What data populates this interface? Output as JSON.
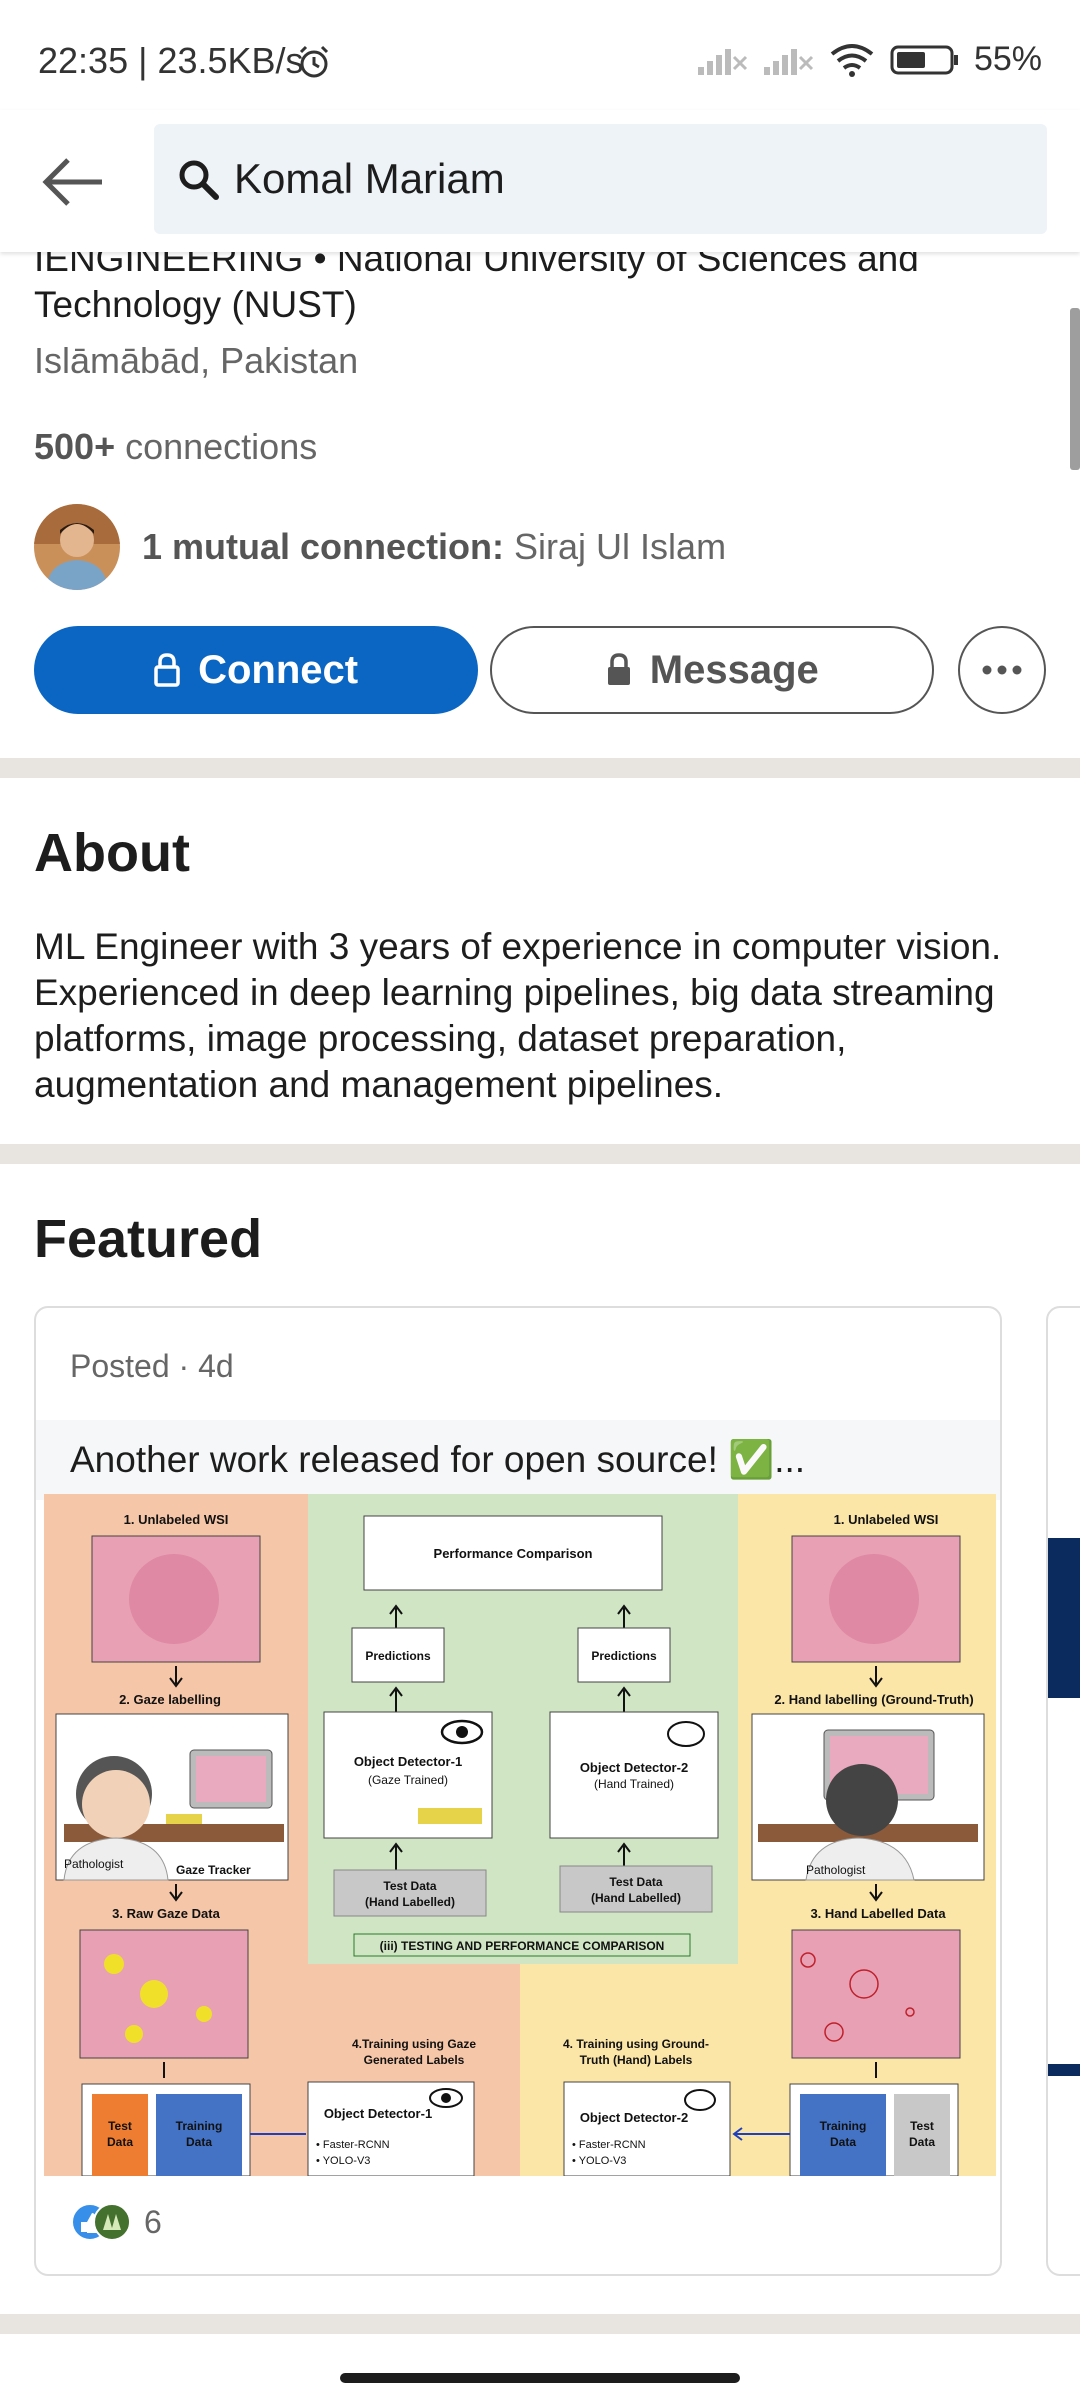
{
  "status_bar": {
    "time_speed": "22:35 | 23.5KB/s",
    "battery": "55%"
  },
  "search": {
    "query": "Komal Mariam"
  },
  "profile": {
    "headline": "IENGINEERING • National University of Sciences and Technology (NUST)",
    "location": "Islāmābād, Pakistan",
    "connections_count": "500+",
    "connections_label": " connections",
    "mutual_label": "1 mutual connection: ",
    "mutual_name": "Siraj Ul Islam",
    "connect_label": "Connect",
    "message_label": "Message"
  },
  "about": {
    "title": "About",
    "text": "ML Engineer with 3 years of experience in computer vision. Experienced in deep learning pipelines, big data streaming platforms, image processing, dataset preparation, augmentation and management pipelines."
  },
  "featured": {
    "title": "Featured",
    "post": {
      "meta": "Posted · 4d",
      "text": "Another work released for open source! ✅...",
      "reaction_count": "6",
      "diagram": {
        "left_title": "1. Unlabeled WSI",
        "gaze_labelling": "2. Gaze labelling",
        "pathologist": "Pathologist",
        "gaze_tracker": "Gaze Tracker",
        "raw_gaze": "3. Raw Gaze Data",
        "performance": "Performance Comparison",
        "predictions": "Predictions",
        "od1": "Object Detector-1",
        "od1_sub": "(Gaze Trained)",
        "od2": "Object Detector-2",
        "od2_sub": "(Hand Trained)",
        "test_data": "Test Data",
        "hand_labelled": "(Hand Labelled)",
        "testing_banner": "(iii) TESTING AND PERFORMANCE COMPARISON",
        "right_title": "1. Unlabeled WSI",
        "hand_labelling": "2. Hand labelling (Ground-Truth)",
        "hand_labelled_data": "3. Hand Labelled Data",
        "train_gaze": "4.Training using Gaze",
        "train_gaze2": "Generated Labels",
        "train_gt": "4. Training using Ground-",
        "train_gt2": "Truth (Hand) Labels",
        "test_box": "Test",
        "data_box": "Data",
        "training_box": "Training",
        "faster_rcnn": "• Faster-RCNN",
        "yolo": "• YOLO-V3"
      }
    }
  },
  "colors": {
    "brand_blue": "#0a66c2",
    "divider": "#e8e5e0",
    "search_bg": "#eef3f8"
  }
}
